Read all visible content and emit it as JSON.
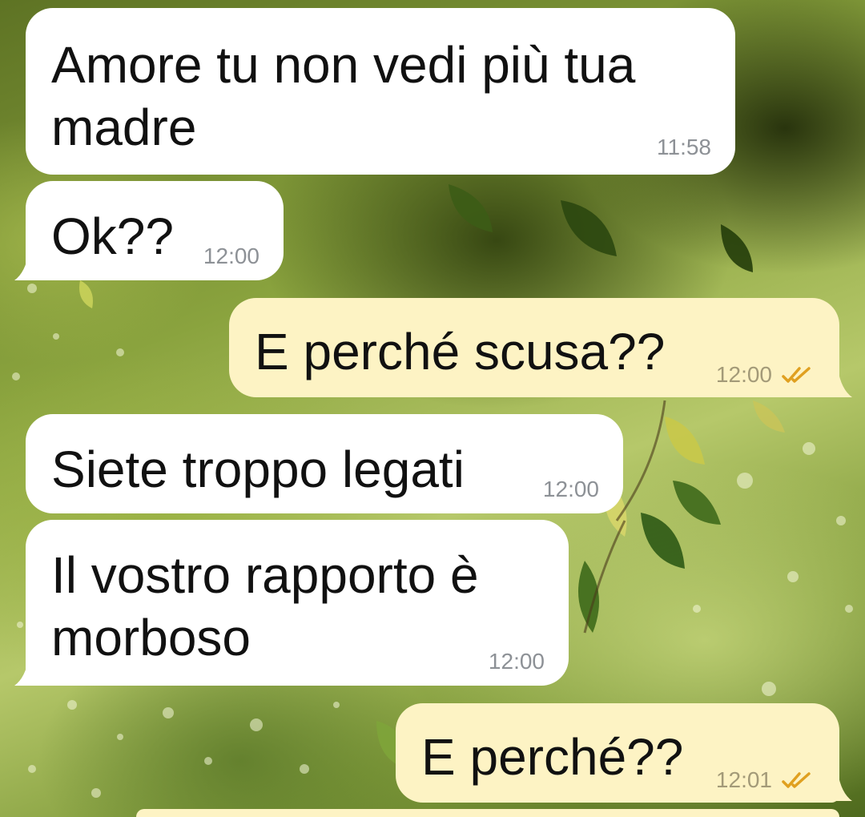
{
  "theme": {
    "incoming_bubble_color": "#ffffff",
    "outgoing_bubble_color": "#fdf3c4",
    "timestamp_color": "#8d9196",
    "read_tick_color": "#e0a020"
  },
  "messages": [
    {
      "direction": "incoming",
      "text": "Amore tu non vedi più tua\nmadre",
      "time": "11:58"
    },
    {
      "direction": "incoming",
      "text": "Ok??",
      "time": "12:00"
    },
    {
      "direction": "outgoing",
      "text": "E perché scusa??",
      "time": "12:00",
      "status_icon": "double-check-read-icon"
    },
    {
      "direction": "incoming",
      "text": "Siete troppo legati",
      "time": "12:00"
    },
    {
      "direction": "incoming",
      "text": "Il vostro rapporto è\nmorboso",
      "time": "12:00"
    },
    {
      "direction": "outgoing",
      "text": "E perché??",
      "time": "12:01",
      "status_icon": "double-check-read-icon"
    }
  ]
}
